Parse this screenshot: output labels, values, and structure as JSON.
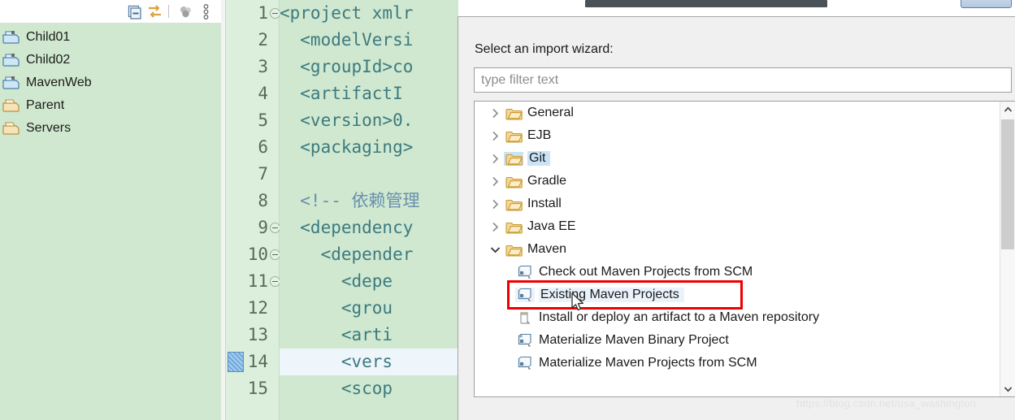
{
  "explorer": {
    "toolbar": [
      {
        "name": "collapse-all-icon",
        "label": "Collapse All"
      },
      {
        "name": "link-with-editor-icon",
        "label": "Link with Editor"
      },
      {
        "name": "filter-icon",
        "label": "Filters"
      },
      {
        "name": "view-menu-icon",
        "label": "View Menu"
      }
    ],
    "projects": [
      {
        "label": "Child01",
        "icon": "maven-project-icon"
      },
      {
        "label": "Child02",
        "icon": "maven-project-icon"
      },
      {
        "label": "MavenWeb",
        "icon": "maven-project-icon"
      },
      {
        "label": "Parent",
        "icon": "folder-project-icon"
      },
      {
        "label": "Servers",
        "icon": "folder-project-icon"
      }
    ]
  },
  "editor": {
    "lines": [
      {
        "num": "1",
        "fold": true,
        "text": "<project xmlr",
        "kind": "tag-attr"
      },
      {
        "num": "2",
        "fold": false,
        "text": "  <modelVersi",
        "kind": "tag"
      },
      {
        "num": "3",
        "fold": false,
        "text": "  <groupId>co",
        "kind": "tag-val"
      },
      {
        "num": "4",
        "fold": false,
        "text": "  <artifactI",
        "kind": "tag"
      },
      {
        "num": "5",
        "fold": false,
        "text": "  <version>0.",
        "kind": "tag-val"
      },
      {
        "num": "6",
        "fold": false,
        "text": "  <packaging>",
        "kind": "tag"
      },
      {
        "num": "7",
        "fold": false,
        "text": "",
        "kind": "tag"
      },
      {
        "num": "8",
        "fold": false,
        "text": "  <!-- 依赖管理",
        "kind": "comment"
      },
      {
        "num": "9",
        "fold": true,
        "text": "  <dependency",
        "kind": "tag"
      },
      {
        "num": "10",
        "fold": true,
        "text": "    <depender",
        "kind": "tag"
      },
      {
        "num": "11",
        "fold": true,
        "text": "      <depe",
        "kind": "tag"
      },
      {
        "num": "12",
        "fold": false,
        "text": "      <grou",
        "kind": "tag"
      },
      {
        "num": "13",
        "fold": false,
        "text": "      <arti",
        "kind": "tag"
      },
      {
        "num": "14",
        "fold": false,
        "text": "      <vers",
        "kind": "tag",
        "current": true,
        "marker": "blue-change-marker"
      },
      {
        "num": "15",
        "fold": false,
        "text": "      <scop",
        "kind": "tag"
      }
    ]
  },
  "dialog": {
    "prompt_label": "Select an import wizard:",
    "filter_placeholder": "type filter text",
    "filter_value": "",
    "tree": [
      {
        "level": 1,
        "label": "General",
        "icon": "folder-icon",
        "twisty": "collapsed",
        "state": ""
      },
      {
        "level": 1,
        "label": "EJB",
        "icon": "folder-icon",
        "twisty": "collapsed",
        "state": ""
      },
      {
        "level": 1,
        "label": "Git",
        "icon": "folder-icon",
        "twisty": "collapsed",
        "state": "hover"
      },
      {
        "level": 1,
        "label": "Gradle",
        "icon": "folder-icon",
        "twisty": "collapsed",
        "state": ""
      },
      {
        "level": 1,
        "label": "Install",
        "icon": "folder-icon",
        "twisty": "collapsed",
        "state": ""
      },
      {
        "level": 1,
        "label": "Java EE",
        "icon": "folder-icon",
        "twisty": "collapsed",
        "state": ""
      },
      {
        "level": 1,
        "label": "Maven",
        "icon": "folder-icon",
        "twisty": "expanded",
        "state": ""
      },
      {
        "level": 2,
        "label": "Check out Maven Projects from SCM",
        "icon": "maven-wizard-icon",
        "twisty": "none",
        "state": ""
      },
      {
        "level": 2,
        "label": "Existing Maven Projects",
        "icon": "maven-wizard-icon",
        "twisty": "none",
        "state": "selected"
      },
      {
        "level": 2,
        "label": "Install or deploy an artifact to a Maven repository",
        "icon": "maven-artifact-icon",
        "twisty": "none",
        "state": ""
      },
      {
        "level": 2,
        "label": "Materialize Maven Binary Project",
        "icon": "maven-binary-icon",
        "twisty": "none",
        "state": ""
      },
      {
        "level": 2,
        "label": "Materialize Maven Projects from SCM",
        "icon": "maven-wizard-icon",
        "twisty": "none",
        "state": ""
      }
    ],
    "scrollbar": {
      "up_arrow": "⌃",
      "down_arrow": "⌄"
    }
  },
  "annotation": {
    "highlight_target": "Existing Maven Projects",
    "color": "#ee0000"
  },
  "watermark": {
    "text": "https://blog.csdn.net/usa_washington"
  }
}
